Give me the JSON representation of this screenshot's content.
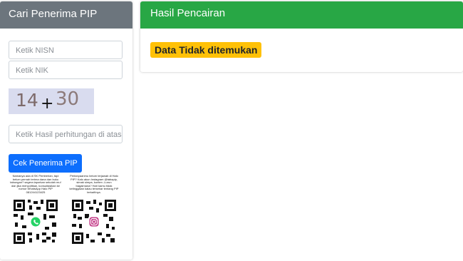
{
  "search_panel": {
    "title": "Cari Penerima PIP",
    "nisn_placeholder": "Ketik NISN",
    "nik_placeholder": "Ketik NIK",
    "captcha": {
      "left": "14",
      "operator": "+",
      "right": "30"
    },
    "answer_placeholder": "Ketik Hasil perhitungan di atas",
    "submit_label": "Cek Penerima PIP",
    "info_left": "Namanya ada di SK Pemberian, tapi belum pernah terima dana dan buku tabungan? segera laporkan sekolah mu! dan jika menyulitkan, konsultasikan ke nomor WhatsApp Halo PIP 081244123425",
    "info_right": "Pertanyaanmu belum terjawab di Halo PIP? Kalo akun Instagram @tabapip, simak simpa, konten -Lurun bagaimana? Hari kamu tidak ketinggalan kalau tersebar tentang PIP terkait!nya.",
    "qr_left_icon": "whatsapp-icon",
    "qr_right_icon": "instagram-icon"
  },
  "result_panel": {
    "title": "Hasil Pencairan",
    "status": "Data Tidak ditemukan"
  },
  "colors": {
    "search_header": "#6c757d",
    "result_header": "#28a745",
    "button": "#0d6efd",
    "badge": "#ffc107"
  }
}
